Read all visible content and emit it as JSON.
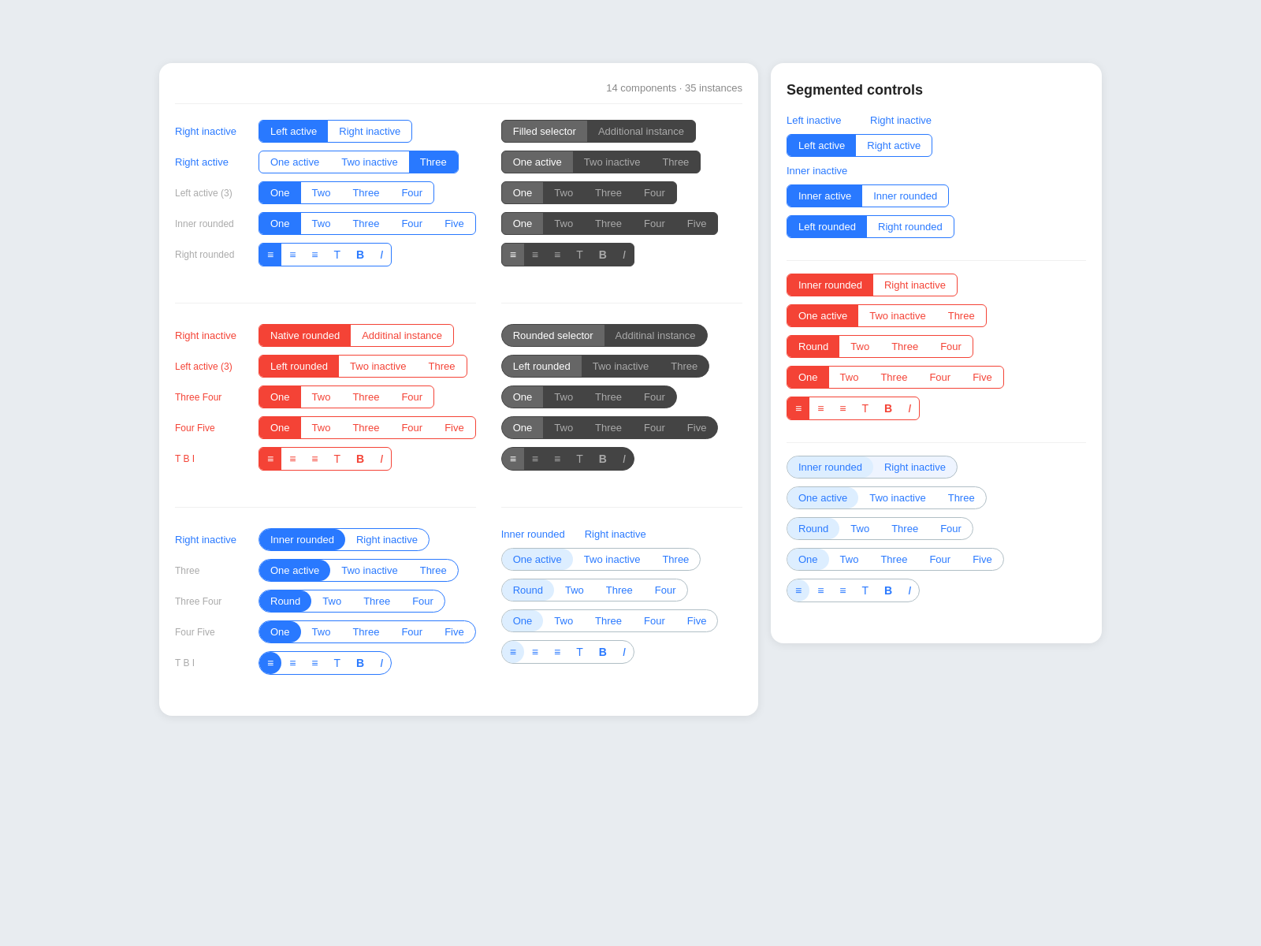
{
  "leftCard": {
    "header": "14 components · 35 instances",
    "sections": {
      "blueNative": {
        "labels": [
          "Right inactive",
          "Right active",
          "Left active (3)"
        ],
        "buttons": {
          "row1": [
            "Left active",
            "Right inactive"
          ],
          "row2": [
            "One active",
            "Two inactive",
            "Three"
          ],
          "row3": [
            "One",
            "Two",
            "Three",
            "Four"
          ],
          "row4": [
            "One",
            "Two",
            "Three",
            "Four",
            "Five"
          ],
          "row5icons": [
            "≡",
            "≡",
            "≡",
            "T",
            "B",
            "I"
          ]
        }
      }
    }
  },
  "rightCard": {
    "title": "Segmented controls"
  },
  "colors": {
    "blue": "#2979ff",
    "red": "#f44336",
    "dark": "#3c3c3c",
    "lightBlue": "#ddeeff"
  }
}
